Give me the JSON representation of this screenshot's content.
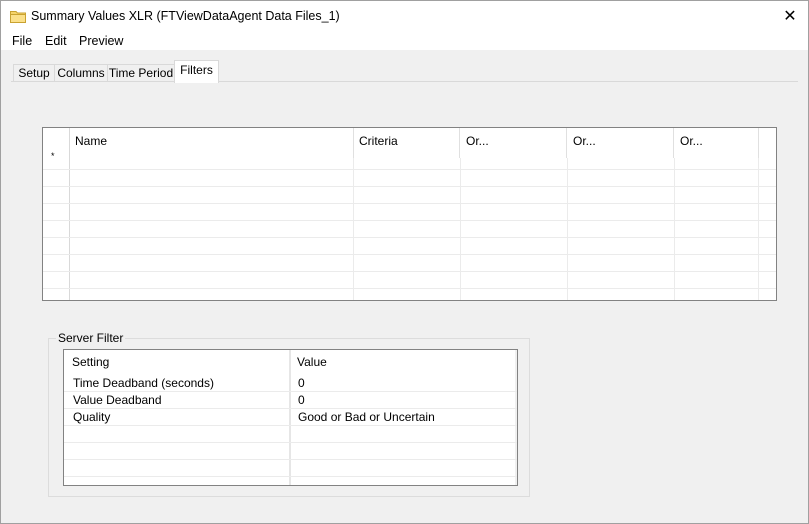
{
  "window": {
    "title": "Summary Values XLR (FTViewDataAgent Data Files_1)",
    "close_glyph": "✕"
  },
  "menu": [
    "File",
    "Edit",
    "Preview"
  ],
  "tabs": [
    {
      "label": "Setup",
      "active": false
    },
    {
      "label": "Columns",
      "active": false
    },
    {
      "label": "Time Period",
      "active": false
    },
    {
      "label": "Filters",
      "active": true
    }
  ],
  "filter_grid": {
    "columns": [
      "Name",
      "Criteria",
      "Or...",
      "Or...",
      "Or..."
    ],
    "new_row_marker": "*"
  },
  "server_filter": {
    "label": "Server Filter",
    "headers": [
      "Setting",
      "Value"
    ],
    "rows": [
      {
        "setting": "Time Deadband (seconds)",
        "value": "0"
      },
      {
        "setting": "Value Deadband",
        "value": "0"
      },
      {
        "setting": "Quality",
        "value": "Good or Bad or Uncertain"
      }
    ]
  }
}
